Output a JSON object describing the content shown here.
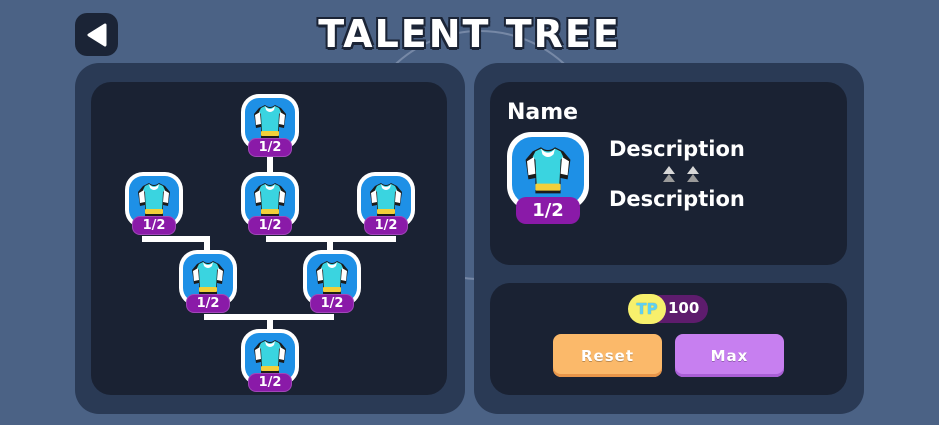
{
  "header": {
    "title": "TALENT TREE",
    "back_icon": "back-arrow-icon"
  },
  "tree": {
    "nodes": [
      {
        "id": "top",
        "level": "1/2",
        "icon": "shirt-icon"
      },
      {
        "id": "row2-left",
        "level": "1/2",
        "icon": "shirt-icon"
      },
      {
        "id": "row2-center",
        "level": "1/2",
        "icon": "shirt-icon"
      },
      {
        "id": "row2-right",
        "level": "1/2",
        "icon": "shirt-icon"
      },
      {
        "id": "row3-left",
        "level": "1/2",
        "icon": "shirt-icon"
      },
      {
        "id": "row3-right",
        "level": "1/2",
        "icon": "shirt-icon"
      },
      {
        "id": "bottom",
        "level": "1/2",
        "icon": "shirt-icon"
      }
    ]
  },
  "detail": {
    "name": "Name",
    "level": "1/2",
    "icon": "shirt-icon",
    "description_top": "Description",
    "description_bottom": "Description",
    "arrow_icon": "up-arrows-icon"
  },
  "points": {
    "tp_label": "TP",
    "tp_value": "100"
  },
  "actions": {
    "reset_label": "Reset",
    "max_label": "Max"
  },
  "colors": {
    "background": "#4b6285",
    "panel": "#2a3a55",
    "inner_panel": "#1a2233",
    "node_blue": "#1e90e6",
    "badge_purple": "#8a1aa8",
    "reset_orange": "#fbb96a",
    "max_purple": "#c77ff0",
    "tp_yellow": "#f7f06c"
  }
}
